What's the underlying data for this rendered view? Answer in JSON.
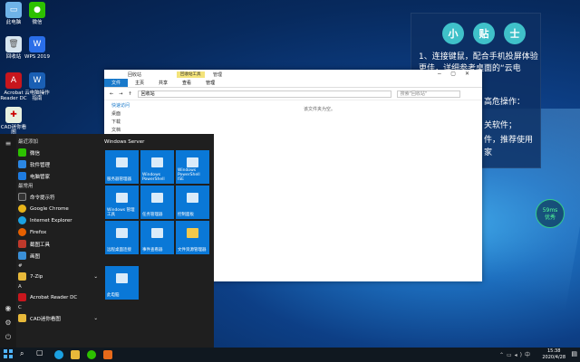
{
  "desktop": {
    "icons": [
      {
        "label": "此电脑"
      },
      {
        "label": "微信"
      },
      {
        "label": "回收站"
      },
      {
        "label": "WPS 2019"
      },
      {
        "label": "Acrobat Reader DC"
      },
      {
        "label": "云电脑操作指南"
      },
      {
        "label": "CAD迷你看图"
      }
    ]
  },
  "tip": {
    "title": [
      "小",
      "贴",
      "士"
    ],
    "line1": "1、连接键鼠，配合手机投屏体验更佳，详细参考桌面的“云电",
    "line2": "高危操作：",
    "line3": "关软件；",
    "line4": "件，推荐使用",
    "line5": "家"
  },
  "explorer": {
    "context_tab": "回收站工具",
    "title_tab": "管理",
    "window_title": "回收站",
    "tabs": [
      "文件",
      "主页",
      "共享",
      "查看",
      "管理"
    ],
    "address": "回收站",
    "search_placeholder": "搜索\"回收站\"",
    "nav": [
      "快速访问",
      "桌面",
      "下载",
      "文档"
    ],
    "empty_text": "该文件夹为空。"
  },
  "start_menu": {
    "recent_header": "最近添加",
    "recent": [
      {
        "label": "微信"
      },
      {
        "label": "软件管理"
      },
      {
        "label": "电脑管家"
      }
    ],
    "common_header": "最常用",
    "common": [
      {
        "label": "命令提示符"
      },
      {
        "label": "Google Chrome"
      },
      {
        "label": "Internet Explorer"
      },
      {
        "label": "Firefox"
      },
      {
        "label": "截图工具"
      },
      {
        "label": "画图"
      }
    ],
    "sections": [
      {
        "letter": "#",
        "items": [
          {
            "label": "7-Zip"
          }
        ]
      },
      {
        "letter": "A",
        "items": [
          {
            "label": "Acrobat Reader DC"
          }
        ]
      },
      {
        "letter": "C",
        "items": [
          {
            "label": "CAD迷你看图"
          }
        ]
      }
    ],
    "tiles_header": "Windows Server",
    "tiles": [
      "服务器管理器",
      "Windows PowerShell",
      "Windows PowerShell ISE",
      "Windows 管理工具",
      "任务管理器",
      "控制面板",
      "远程桌面连接",
      "事件查看器",
      "文件资源管理器",
      "此电脑"
    ]
  },
  "taskbar": {
    "time": "15:38",
    "date": "2020/4/28"
  },
  "net_badge": {
    "latency": "59ms",
    "quality": "优秀"
  }
}
